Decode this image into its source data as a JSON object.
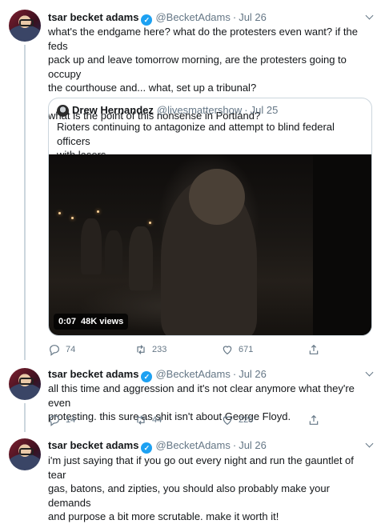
{
  "tweets": [
    {
      "author": {
        "name": "tsar becket adams",
        "handle": "@BecketAdams",
        "date": "Jul 26"
      },
      "text_lines": [
        "what's the endgame here? what do the protesters even want? if the feds",
        "pack up and leave tomorrow morning, are the protesters going to occupy",
        "the courthouse and... what, set up a tribunal?",
        "",
        "what is the point of this nonsense in Portland?"
      ],
      "quoted": {
        "author": {
          "name": "Drew Hernandez",
          "handle": "@livesmattershow",
          "date": "Jul 25"
        },
        "text_lines": [
          "Rioters continuing to antagonize and attempt to blind federal officers",
          "with lasers"
        ],
        "video": {
          "duration": "0:07",
          "views": "48K views"
        }
      },
      "stats": {
        "replies": "74",
        "retweets": "233",
        "likes": "671"
      }
    },
    {
      "author": {
        "name": "tsar becket adams",
        "handle": "@BecketAdams",
        "date": "Jul 26"
      },
      "text_lines": [
        "all this time and aggression and it's not clear anymore what they're even",
        "protesting. this sure as shit isn't about George Floyd."
      ],
      "stats": {
        "replies": "14",
        "retweets": "44",
        "likes": "226"
      }
    },
    {
      "author": {
        "name": "tsar becket adams",
        "handle": "@BecketAdams",
        "date": "Jul 26"
      },
      "text_lines": [
        "i'm just saying that if you go out every night and run the gauntlet of tear",
        "gas, batons, and zipties, you should also probably make your demands",
        "and purpose a bit more scrutable. make it worth it!"
      ]
    }
  ],
  "glyphs": {
    "dot": "·",
    "verified": "✓"
  },
  "colors": {
    "accent": "#1da1f2",
    "secondary_text": "#657786",
    "border": "#ccd6dd"
  },
  "icons": [
    "reply-icon",
    "retweet-icon",
    "like-icon",
    "share-icon",
    "caret-down-icon",
    "verified-badge-icon"
  ]
}
